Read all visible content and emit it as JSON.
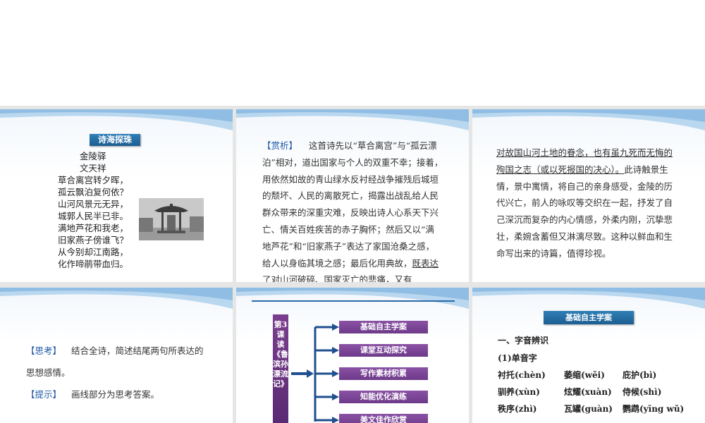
{
  "slide1": {
    "badge": "诗海探珠",
    "title": "金陵驿",
    "author": "文天祥",
    "lines": [
      "草合离宫转夕晖，",
      "孤云飘泊复何依？",
      "山河风景元无异，",
      "城郭人民半已非。",
      "满地芦花和我老，",
      "旧家燕子傍谁飞？",
      "从今别却江南路，",
      "化作啼鹃带血归。"
    ]
  },
  "slide2": {
    "tag": "【赏析】",
    "lines": [
      "这首诗先以“草合离宫”与“孤云漂",
      "泊”相对，道出国家与个人的双重不幸；接着，",
      "用依然如故的青山绿水反衬经战争摧残后城垣",
      "的颓坏、人民的离散死亡，揭露出战乱给人民",
      "群众带来的深重灾难，反映出诗人心系天下兴",
      "亡、情关百姓疾苦的赤子胸怀；然后又以“满",
      "地芦花”和“旧家燕子”表达了家国沧桑之感，"
    ],
    "line8_plain": "给人以身临其境之感；最后化用典故，",
    "line8_ul": "既表达",
    "line9_ul": "了对山河破碎、国家灭亡的悲痛，又有"
  },
  "slide3": {
    "line1_ul": "对故国山河土地的眷念，也有虽九死而无悔的",
    "line2_ul": "殉国之志（或以死报国的决心）。",
    "line2_plain": "此诗触景生",
    "lines": [
      "情，景中寓情，将自己的亲身感受，金陵的历",
      "代兴亡，前人的咏叹等交织在一起，抒发了自",
      "己深沉而复杂的内心情感，外柔内刚，沉挚悲",
      "壮，柔婉含蓄但又淋漓尽致。这种以鲜血和生",
      "命写出来的诗篇，值得珍视。"
    ]
  },
  "slide4": {
    "think_tag": "【思考】",
    "think_text": "结合全诗，简述结尾两句所表达的",
    "think_text2": "思想感情。",
    "hint_tag": "【提示】",
    "hint_text": "画线部分为思考答案。"
  },
  "slide5": {
    "vertical_title": "第3课　读《鲁滨孙漂流记》",
    "menu": [
      "基础自主学案",
      "课堂互动探究",
      "写作素材积累",
      "知能优化演练",
      "美文佳作欣赏"
    ],
    "colors": {
      "menu": "#7a449a",
      "arrow": "#1f4f8f",
      "rule": "#2a6aa6"
    }
  },
  "slide6": {
    "badge": "基础自主学案",
    "section": "一、字音辨识",
    "subsection": "(1)单音字",
    "rows": [
      [
        "衬托(chèn)",
        "萎缩(wěi)",
        "庇护(bì)"
      ],
      [
        "驯养(xùn)",
        "炫耀(xuàn)",
        "侍候(shì)"
      ],
      [
        "秩序(zhì)",
        "瓦罐(guàn)",
        "鹦鹉(yīng wǔ)"
      ]
    ]
  }
}
